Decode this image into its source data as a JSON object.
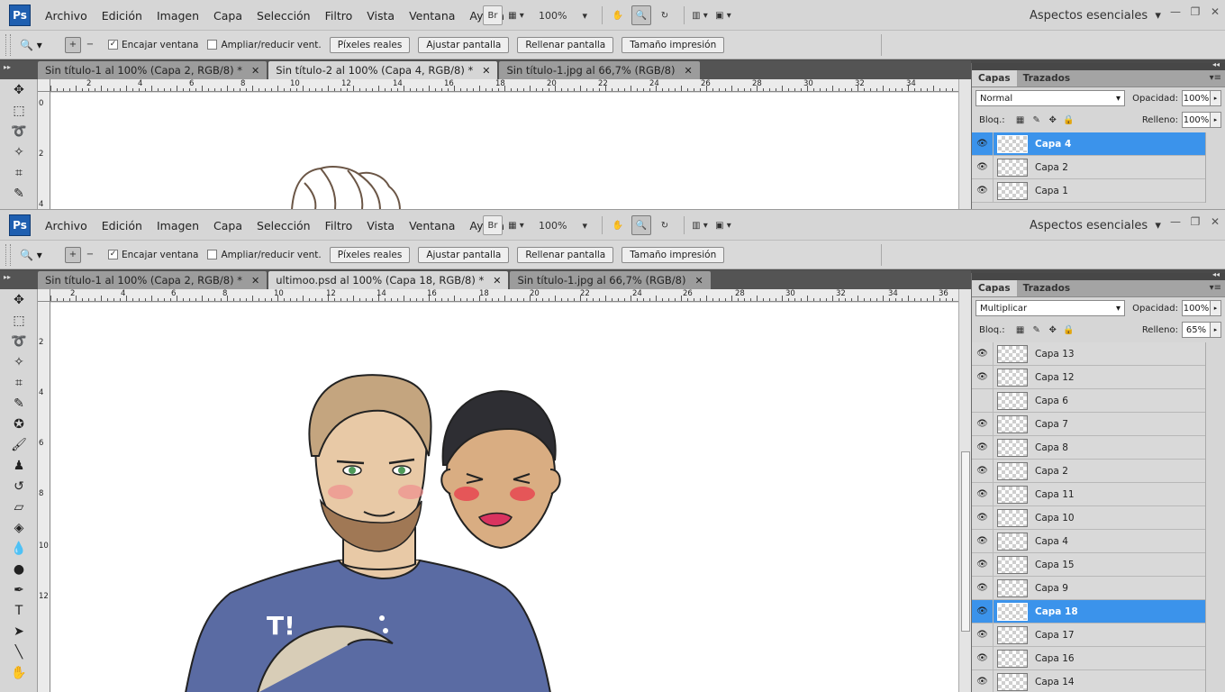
{
  "app": {
    "logo": "Ps",
    "workspace": "Aspectos esenciales"
  },
  "menu": [
    "Archivo",
    "Edición",
    "Imagen",
    "Capa",
    "Selección",
    "Filtro",
    "Vista",
    "Ventana",
    "Ayuda"
  ],
  "zoom_level": "100%",
  "bridge_label": "Br",
  "options": {
    "fit_window": "Encajar ventana",
    "resize_window": "Ampliar/reducir vent.",
    "actual_pixels": "Píxeles reales",
    "fit_screen": "Ajustar pantalla",
    "fill_screen": "Rellenar pantalla",
    "print_size": "Tamaño impresión"
  },
  "panel": {
    "tab_layers": "Capas",
    "tab_paths": "Trazados",
    "opacity_label": "Opacidad:",
    "lock_label": "Bloq.:",
    "fill_label": "Relleno:"
  },
  "window1": {
    "tabs": [
      {
        "label": "Sin título-1 al 100% (Capa 2, RGB/8) *",
        "active": false
      },
      {
        "label": "Sin título-2 al 100% (Capa 4, RGB/8) *",
        "active": true
      },
      {
        "label": "Sin título-1.jpg al 66,7% (RGB/8)",
        "active": false
      }
    ],
    "blend_mode": "Normal",
    "opacity": "100%",
    "fill": "100%",
    "ruler_top": [
      "2",
      "4",
      "6",
      "8",
      "10",
      "12",
      "14",
      "16",
      "18",
      "20",
      "22",
      "24",
      "26",
      "28",
      "30",
      "32",
      "34"
    ],
    "ruler_left": [
      "0",
      "2",
      "4"
    ],
    "layers": [
      {
        "name": "Capa 4",
        "visible": true,
        "selected": true
      },
      {
        "name": "Capa 2",
        "visible": true,
        "selected": false
      },
      {
        "name": "Capa 1",
        "visible": true,
        "selected": false
      }
    ]
  },
  "window2": {
    "tabs": [
      {
        "label": "Sin título-1 al 100% (Capa 2, RGB/8) *",
        "active": false
      },
      {
        "label": "ultimoo.psd al 100% (Capa 18, RGB/8) *",
        "active": true
      },
      {
        "label": "Sin título-1.jpg al 66,7% (RGB/8)",
        "active": false
      }
    ],
    "blend_mode": "Multiplicar",
    "opacity": "100%",
    "fill": "65%",
    "ruler_top": [
      "2",
      "4",
      "6",
      "8",
      "10",
      "12",
      "14",
      "16",
      "18",
      "20",
      "22",
      "24",
      "26",
      "28",
      "30",
      "32",
      "34",
      "36"
    ],
    "ruler_left": [
      "2",
      "4",
      "6",
      "8",
      "10",
      "12"
    ],
    "shirt_text": "T!",
    "layers": [
      {
        "name": "Capa 13",
        "visible": true,
        "selected": false
      },
      {
        "name": "Capa 12",
        "visible": true,
        "selected": false
      },
      {
        "name": "Capa 6",
        "visible": false,
        "selected": false
      },
      {
        "name": "Capa 7",
        "visible": true,
        "selected": false
      },
      {
        "name": "Capa 8",
        "visible": true,
        "selected": false
      },
      {
        "name": "Capa 2",
        "visible": true,
        "selected": false
      },
      {
        "name": "Capa 11",
        "visible": true,
        "selected": false
      },
      {
        "name": "Capa 10",
        "visible": true,
        "selected": false
      },
      {
        "name": "Capa 4",
        "visible": true,
        "selected": false
      },
      {
        "name": "Capa 15",
        "visible": true,
        "selected": false
      },
      {
        "name": "Capa 9",
        "visible": true,
        "selected": false
      },
      {
        "name": "Capa 18",
        "visible": true,
        "selected": true
      },
      {
        "name": "Capa 17",
        "visible": true,
        "selected": false
      },
      {
        "name": "Capa 16",
        "visible": true,
        "selected": false
      },
      {
        "name": "Capa 14",
        "visible": true,
        "selected": false
      }
    ]
  },
  "colors": {
    "selection": "#3b93eb",
    "shirt": "#5a6ba3",
    "skin": "#e8c9a6",
    "hair_dark": "#2e2e33",
    "hair_light": "#c4a57f"
  }
}
